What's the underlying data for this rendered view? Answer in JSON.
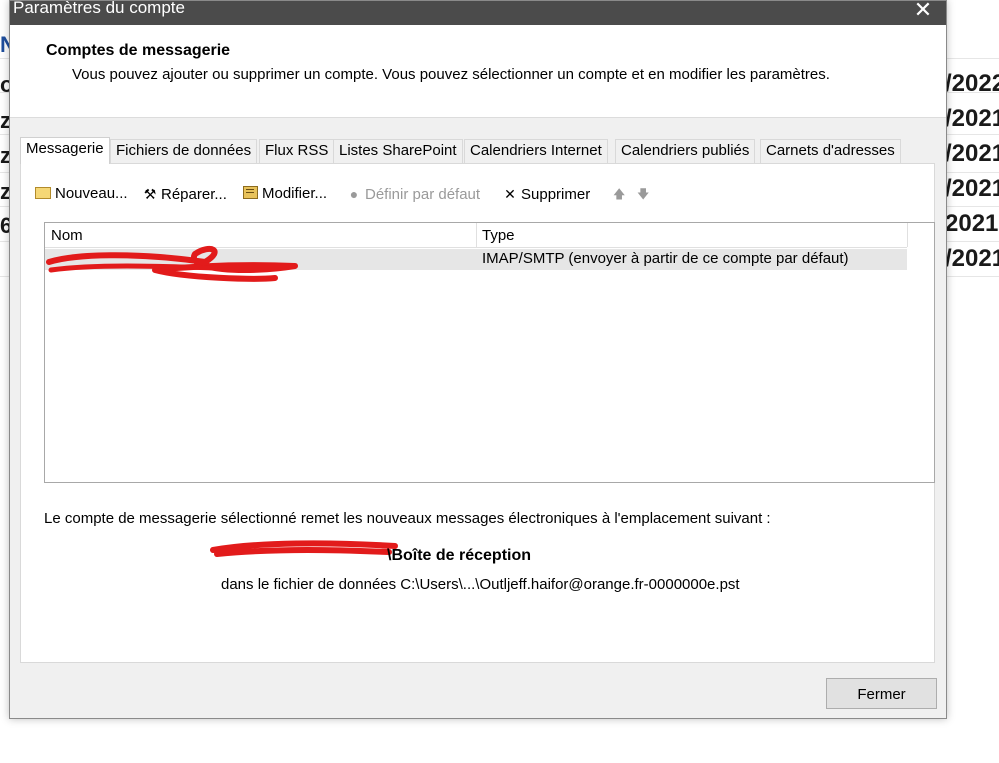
{
  "background": {
    "left_chars": [
      "N",
      "o",
      "z",
      "z",
      "z",
      "6"
    ],
    "dates": [
      "/2022",
      "/2021",
      "/2021",
      "/2021",
      "2021",
      "/2021"
    ]
  },
  "dialog": {
    "title": "Paramètres du compte",
    "close_glyph": "✕",
    "header_title": "Comptes de messagerie",
    "header_desc": "Vous pouvez ajouter ou supprimer un compte. Vous pouvez sélectionner un compte et en modifier les paramètres."
  },
  "tabs": [
    {
      "label": "Messagerie",
      "active": true
    },
    {
      "label": "Fichiers de données"
    },
    {
      "label": "Flux RSS"
    },
    {
      "label": "Listes SharePoint"
    },
    {
      "label": "Calendriers Internet"
    },
    {
      "label": "Calendriers publiés"
    },
    {
      "label": "Carnets d'adresses"
    }
  ],
  "toolbar": {
    "new": "Nouveau...",
    "repair": "Réparer...",
    "modify": "Modifier...",
    "set_default": "Définir par défaut",
    "delete": "Supprimer",
    "up_glyph": "🡅",
    "down_glyph": "🡇"
  },
  "list": {
    "col_name": "Nom",
    "col_type": "Type",
    "rows": [
      {
        "name": "",
        "type": "IMAP/SMTP (envoyer à partir de ce compte par défaut)"
      }
    ]
  },
  "delivery": {
    "text": "Le compte de messagerie sélectionné remet les nouveaux messages électroniques à l'emplacement suivant :",
    "folder": "\\Boîte de réception",
    "file": "dans le fichier de données C:\\Users\\...\\Outljeff.haifor@orange.fr-0000000e.pst"
  },
  "buttons": {
    "close": "Fermer"
  },
  "colors": {
    "titlebar": "#4b4b4b",
    "redaction": "#e21b1b",
    "row_selected": "#e6e6e6"
  }
}
